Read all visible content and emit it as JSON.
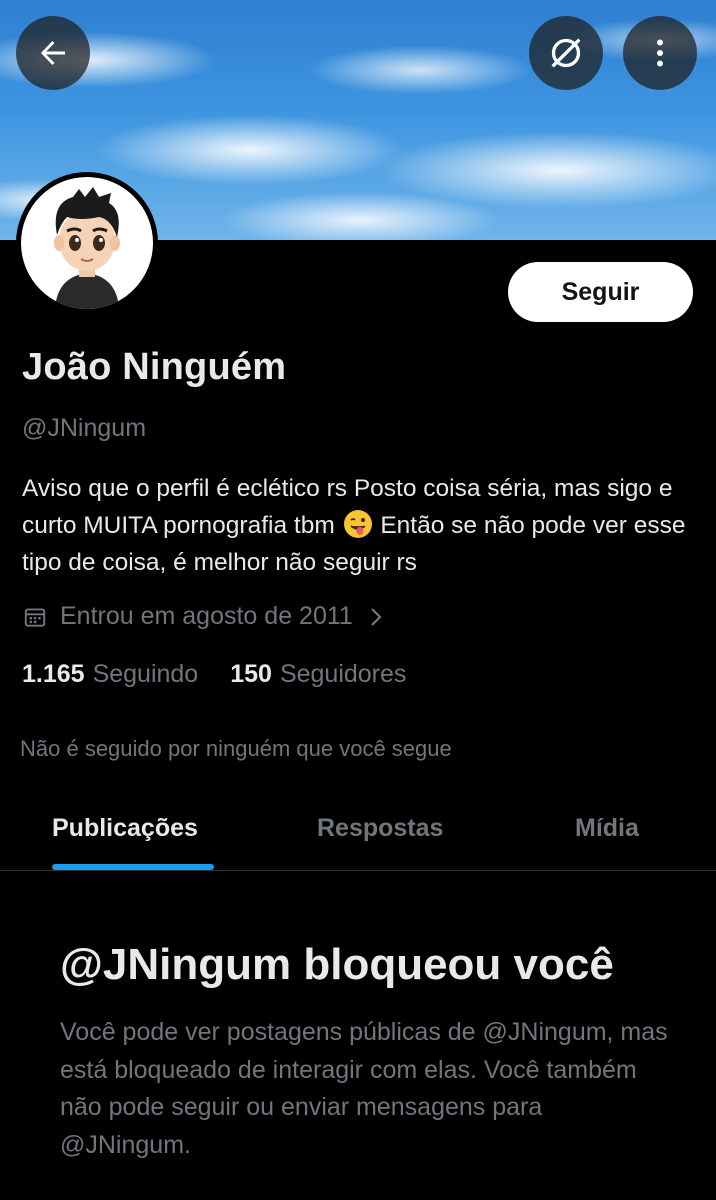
{
  "header": {
    "back_icon": "arrow-left-icon",
    "block_icon": "block-icon",
    "more_icon": "more-vertical-icon"
  },
  "profile": {
    "name": "João Ninguém",
    "handle": "@JNingum",
    "follow_label": "Seguir",
    "bio_part1": "Aviso que o perfil é eclético rs Posto coisa séria, mas sigo e curto MUITA pornografia tbm ",
    "bio_part2": " Então se não pode ver esse tipo de coisa, é melhor não seguir rs",
    "joined": "Entrou em agosto de 2011",
    "following_count": "1.165",
    "following_label": "Seguindo",
    "followers_count": "150",
    "followers_label": "Seguidores",
    "mutual_note": "Não é seguido por ninguém que você segue"
  },
  "tabs": [
    {
      "label": "Publicações",
      "active": true
    },
    {
      "label": "Respostas",
      "active": false
    },
    {
      "label": "Mídia",
      "active": false
    }
  ],
  "blocked": {
    "title": "@JNingum bloqueou você",
    "description": "Você pode ver postagens públicas de @JNingum, mas está bloqueado de interagir com elas. Você também não pode seguir ou enviar mensagens para @JNingum."
  },
  "colors": {
    "background": "#000000",
    "text_primary": "#e7e9ea",
    "text_secondary": "#71767b",
    "accent": "#1d9bf0"
  }
}
